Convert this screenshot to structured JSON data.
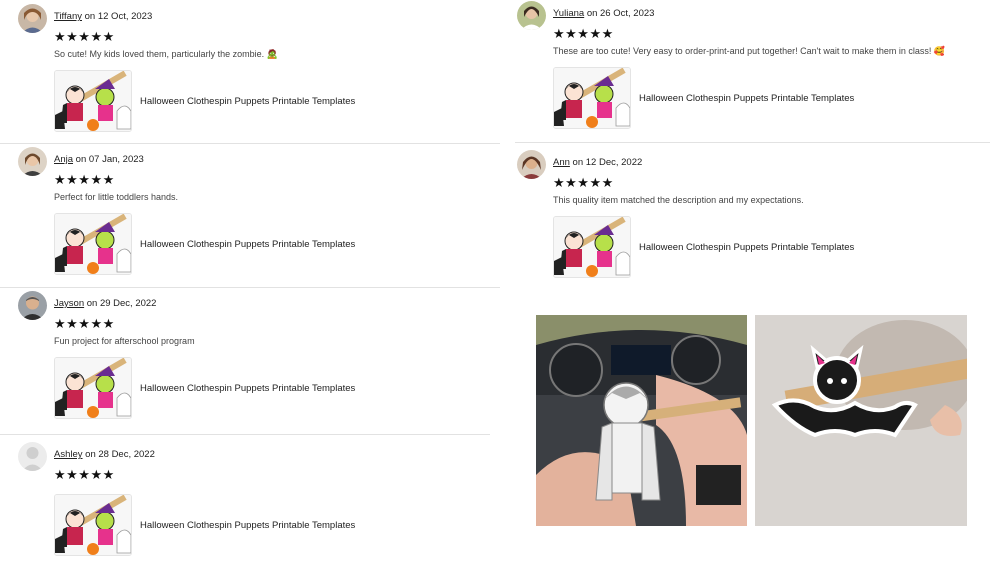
{
  "product_title": "Halloween Clothespin Puppets Printable Templates",
  "stars": "★★★★★",
  "reviews": [
    {
      "user": "Tiffany",
      "date_text": "on 12 Oct, 2023",
      "text": "So cute! My kids loved them, particularly the zombie. 🧟",
      "avatar_icon": "woman-avatar"
    },
    {
      "user": "Anja",
      "date_text": "on 07 Jan, 2023",
      "text": "Perfect for little toddlers hands.",
      "avatar_icon": "woman-avatar"
    },
    {
      "user": "Jayson",
      "date_text": "on 29 Dec, 2022",
      "text": "Fun project for afterschool program",
      "avatar_icon": "man-avatar"
    },
    {
      "user": "Ashley",
      "date_text": "on 28 Dec, 2022",
      "text": "",
      "avatar_icon": "default-avatar"
    },
    {
      "user": "Yuliana",
      "date_text": "on 26 Oct, 2023",
      "text": "These are too cute! Very easy to order-print-and put together! Can't wait to make them in class! 🥰",
      "avatar_icon": "woman-avatar"
    },
    {
      "user": "Ann",
      "date_text": "on 12 Dec, 2022",
      "text": "This quality item matched the description and my expectations.",
      "avatar_icon": "woman-avatar"
    }
  ],
  "photos": [
    {
      "name": "vampire-puppet-photo"
    },
    {
      "name": "bat-puppet-photo"
    }
  ],
  "colors": {
    "divider": "#e2e2e2",
    "star": "#111111",
    "puppet_pink": "#e6328c",
    "puppet_green": "#b7e04a",
    "puppet_orange": "#f07f1a"
  }
}
